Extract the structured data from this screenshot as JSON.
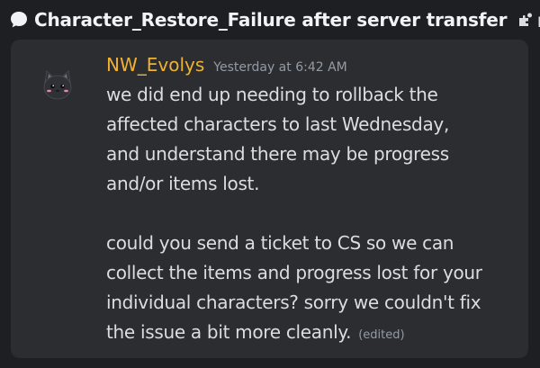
{
  "thread": {
    "title": "Character_Restore_Failure after server transfer",
    "tag_label": "playe",
    "tag_icon": "puzzle-tag-icon",
    "thread_icon": "speech-bubble-icon"
  },
  "message": {
    "author": "NW_Evolys",
    "author_color": "#f0b232",
    "timestamp": "Yesterday at 6:42 AM",
    "paragraph_1_lines": [
      "we did end up needing to rollback the",
      "affected characters to last Wednesday,",
      "and understand there may be progress",
      "and/or items lost."
    ],
    "paragraph_2_lines": [
      "could you send a ticket to CS so we can",
      "collect the items and progress lost for your",
      "individual characters? sorry we couldn't fix",
      "the issue a bit more cleanly."
    ],
    "edited_label": "(edited)",
    "avatar_icon": "black-cat-avatar-icon"
  }
}
